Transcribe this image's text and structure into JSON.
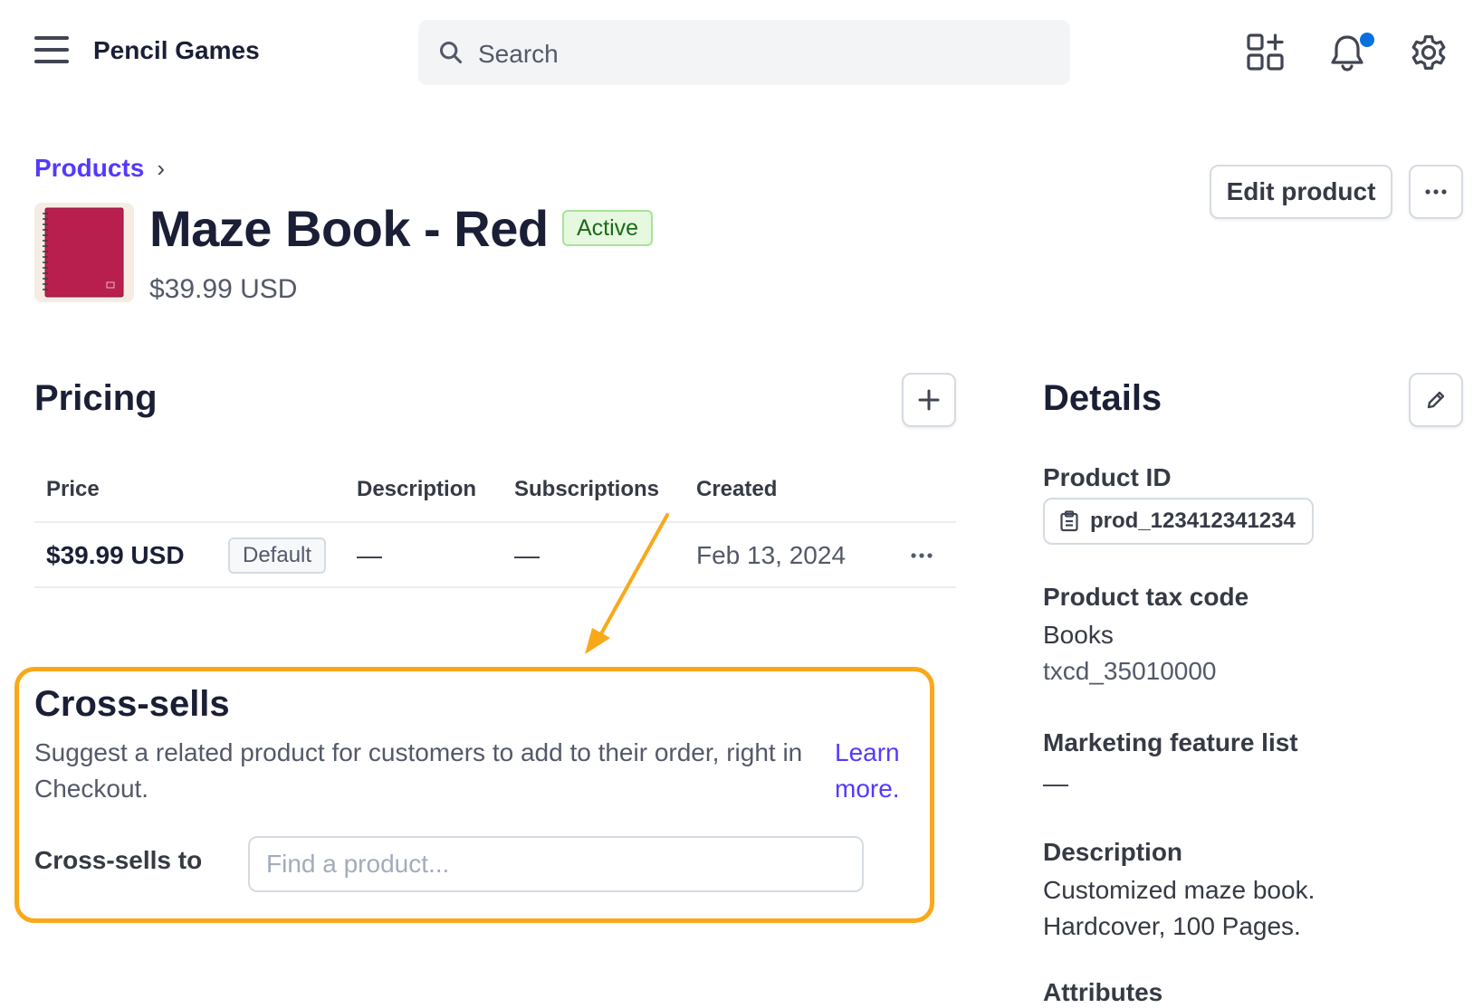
{
  "header": {
    "account_name": "Pencil Games",
    "search_placeholder": "Search"
  },
  "breadcrumb": {
    "parent": "Products"
  },
  "product": {
    "name": "Maze Book - Red",
    "status": "Active",
    "price": "$39.99 USD",
    "edit_label": "Edit product"
  },
  "pricing": {
    "title": "Pricing",
    "columns": [
      "Price",
      "Description",
      "Subscriptions",
      "Created"
    ],
    "rows": [
      {
        "price": "$39.99 USD",
        "badge": "Default",
        "description": "—",
        "subscriptions": "—",
        "created": "Feb 13, 2024"
      }
    ]
  },
  "cross_sells": {
    "title": "Cross-sells",
    "description": "Suggest a related product for customers to add to their order, right in Checkout.",
    "link": "Learn more.",
    "label": "Cross-sells to",
    "input_placeholder": "Find a product...",
    "input_value": ""
  },
  "details": {
    "title": "Details",
    "product_id_label": "Product ID",
    "product_id": "prod_123412341234",
    "tax_code_label": "Product tax code",
    "tax_code_name": "Books",
    "tax_code": "txcd_35010000",
    "marketing_label": "Marketing feature list",
    "marketing_value": "—",
    "description_label": "Description",
    "description_value": "Customized maze book. Hardcover, 100 Pages.",
    "attributes_label": "Attributes"
  },
  "colors": {
    "accent": "#533afd",
    "highlight": "#f9a81a",
    "notification_dot": "#0570de",
    "active_badge": "#e6f8e0"
  }
}
